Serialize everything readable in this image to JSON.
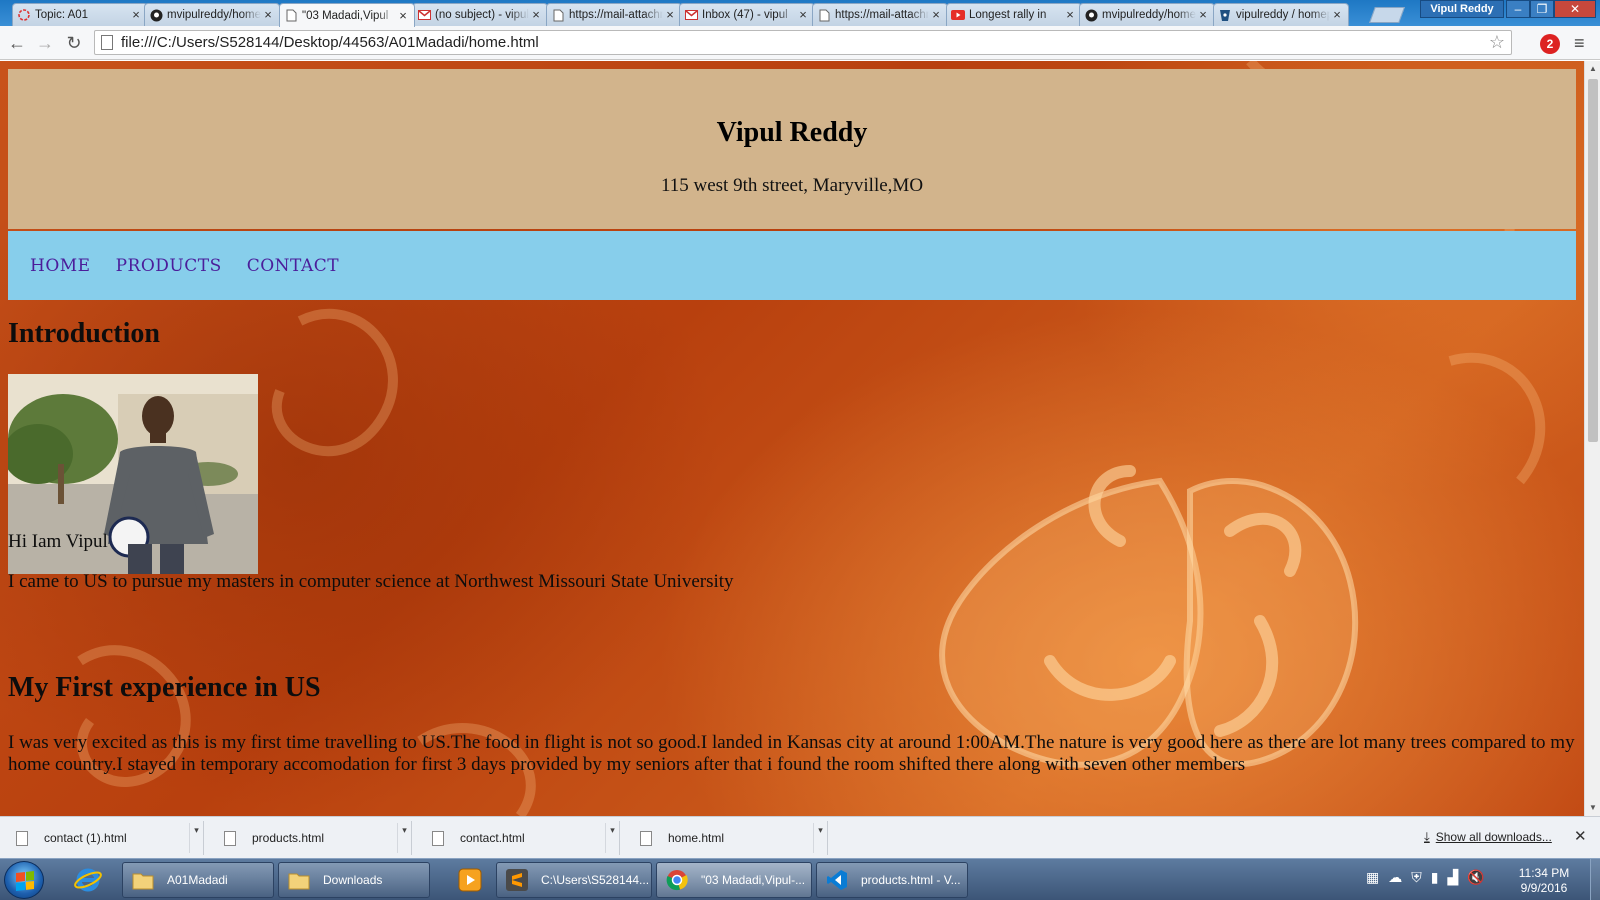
{
  "browser": {
    "tabs": [
      {
        "title": "Topic: A01",
        "icon": "topic-icon",
        "active": false
      },
      {
        "title": "mvipulreddy/homepage",
        "icon": "github-icon",
        "active": false
      },
      {
        "title": "\"03 Madadi,Vipul",
        "icon": "page-icon",
        "active": true
      },
      {
        "title": "(no subject) - vipul",
        "icon": "gmail-icon",
        "active": false
      },
      {
        "title": "https://mail-attachment",
        "icon": "page-icon",
        "active": false
      },
      {
        "title": "Inbox (47) - vipul",
        "icon": "gmail-icon",
        "active": false
      },
      {
        "title": "https://mail-attachment",
        "icon": "page-icon",
        "active": false
      },
      {
        "title": "Longest rally in",
        "icon": "youtube-icon",
        "active": false
      },
      {
        "title": "mvipulreddy/homepage",
        "icon": "github-icon",
        "active": false
      },
      {
        "title": "vipulreddy / homepage",
        "icon": "bitbucket-icon",
        "active": false
      }
    ],
    "profile_name": "Vipul Reddy",
    "url": "file:///C:/Users/S528144/Desktop/44563/A01Madadi/home.html",
    "extension_badge": "2"
  },
  "page": {
    "name": "Vipul Reddy",
    "address": "115 west 9th street, Maryville,MO",
    "nav": [
      "HOME",
      "PRODUCTS",
      "CONTACT"
    ],
    "intro_heading": "Introduction",
    "greeting": "Hi Iam Vipul",
    "intro_text": "I came to US to pursue my masters in computer science at Northwest Missouri State University",
    "experience_heading": "My First experience in US",
    "experience_text": "I was very excited as this is my first time travelling to US.The food in flight is not so good.I landed in Kansas city at around 1:00AM.The nature is very good here as there are lot many trees compared to my home country.I stayed in temporary accomodation for first 3 days provided by my seniors after that i found the room shifted there along with seven other members"
  },
  "downloads": {
    "items": [
      "contact (1).html",
      "products.html",
      "contact.html",
      "home.html"
    ],
    "show_all": "Show all downloads..."
  },
  "taskbar": {
    "tasks": [
      {
        "label": "A01Madadi",
        "icon": "folder-icon"
      },
      {
        "label": "Downloads",
        "icon": "folder-icon"
      },
      {
        "label": "C:\\Users\\S528144...",
        "icon": "sublime-text-icon"
      },
      {
        "label": "\"03 Madadi,Vipul-...",
        "icon": "chrome-icon"
      },
      {
        "label": "products.html - V...",
        "icon": "vscode-icon"
      }
    ],
    "time": "11:34 PM",
    "date": "9/9/2016"
  },
  "colors": {
    "header_bg": "#d2b48c",
    "nav_bg": "#87ceeb",
    "nav_text": "#4b1d9a",
    "page_bg": "#c8521a"
  }
}
